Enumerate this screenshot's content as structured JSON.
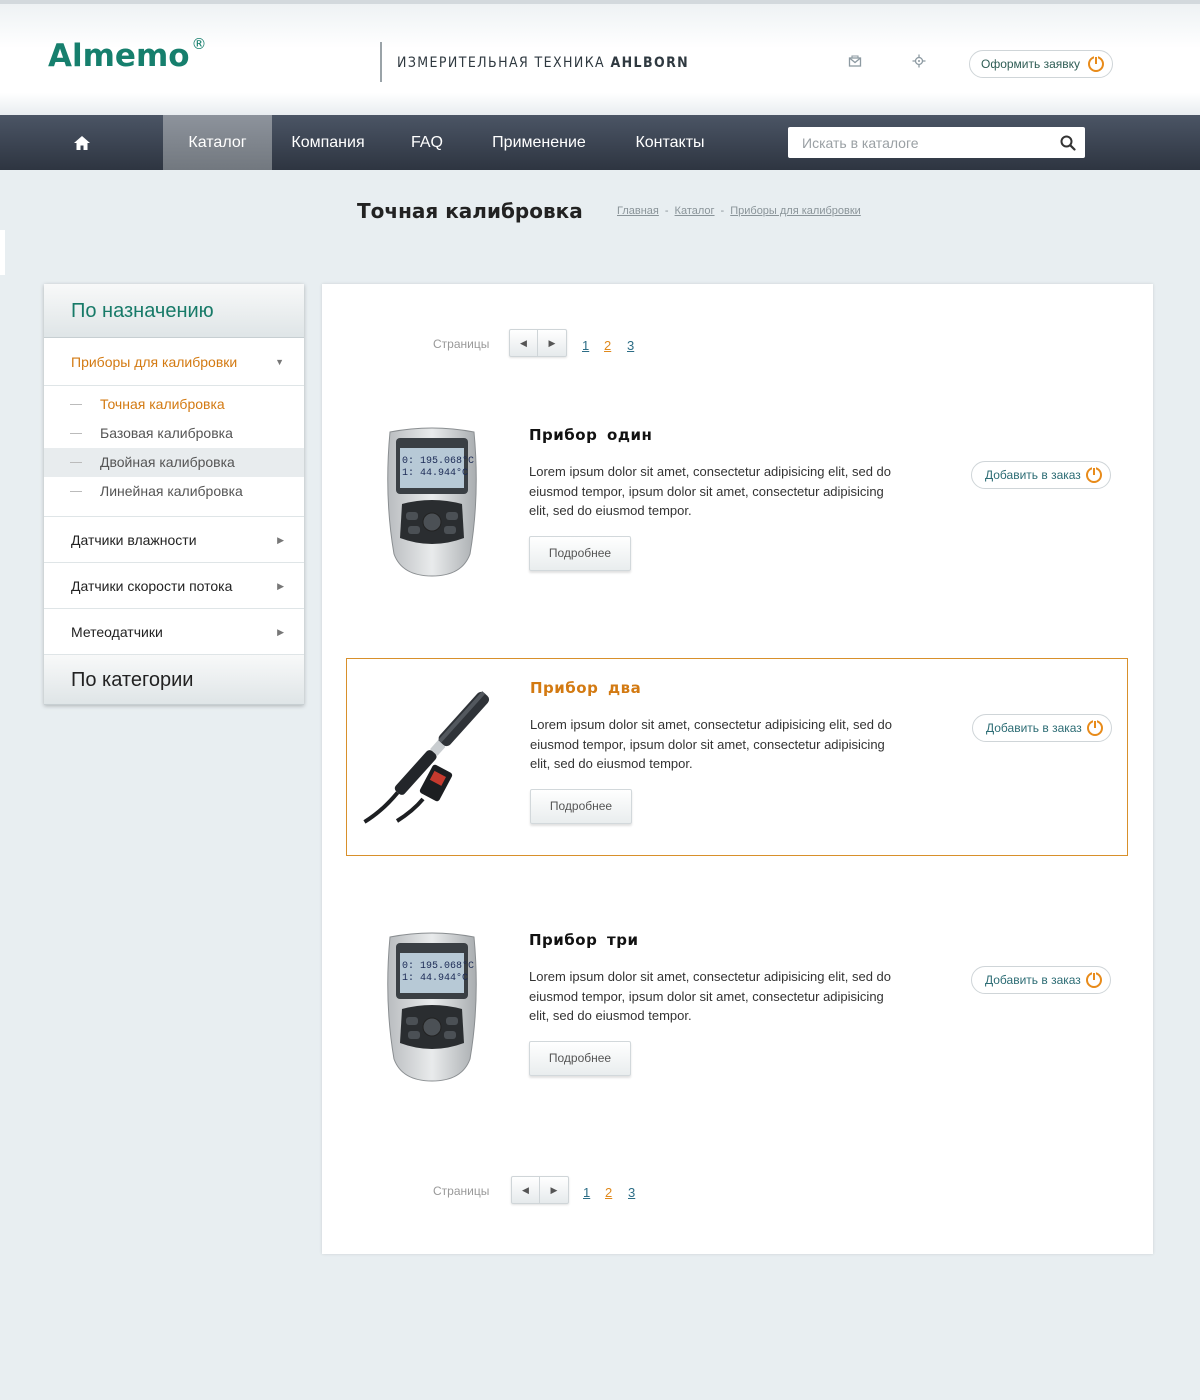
{
  "header": {
    "logo": "Almemo",
    "logo_reg": "®",
    "tagline_prefix": "ИЗМЕРИТЕЛЬНАЯ ТЕХНИКА ",
    "tagline_brand": "AHLBORN",
    "order_button": "Оформить заявку",
    "icons": [
      "mail-icon",
      "map-pin-icon",
      "power-icon"
    ]
  },
  "nav": {
    "home_icon": "home-icon",
    "items": [
      {
        "label": "Каталог",
        "active": true
      },
      {
        "label": "Компания"
      },
      {
        "label": "FAQ"
      },
      {
        "label": "Применение"
      },
      {
        "label": "Контакты"
      }
    ],
    "search_placeholder": "Искать в каталоге",
    "search_icon": "search-icon"
  },
  "page": {
    "title": "Точная калибровка",
    "breadcrumb": [
      "Главная",
      "Каталог",
      "Приборы для калибровки"
    ],
    "breadcrumb_sep": "-"
  },
  "sidebar": {
    "heading_purpose": "По назначению",
    "open_category": "Приборы для калибровки",
    "subitems": [
      {
        "label": "Точная калибровка",
        "current": true
      },
      {
        "label": "Базовая калибровка"
      },
      {
        "label": "Двойная калибровка"
      },
      {
        "label": "Линейная калибровка"
      }
    ],
    "categories": [
      "Датчики влажности",
      "Датчики скорости потока",
      "Метеодатчики"
    ],
    "heading_category": "По категории"
  },
  "pager": {
    "label": "Страницы",
    "pages": [
      "1",
      "2",
      "3"
    ],
    "current": "2"
  },
  "products": [
    {
      "name": "Прибор один",
      "description": "Lorem ipsum dolor sit amet, consectetur adipisicing elit, sed do eiusmod tempor, ipsum dolor sit amet, consectetur adipisicing elit, sed do eiusmod tempor.",
      "more": "Подробнее",
      "add": "Добавить в заказ",
      "device_readout": [
        "0: 195.068°C",
        "1: 44.944°C"
      ]
    },
    {
      "name": "Прибор два",
      "description": "Lorem ipsum dolor sit amet, consectetur adipisicing elit, sed do eiusmod tempor, ipsum dolor sit amet, consectetur adipisicing elit, sed do eiusmod tempor.",
      "more": "Подробнее",
      "add": "Добавить в заказ",
      "highlighted": true
    },
    {
      "name": "Прибор три",
      "description": "Lorem ipsum dolor sit amet, consectetur adipisicing elit, sed do eiusmod tempor, ipsum dolor sit amet, consectetur adipisicing elit, sed do eiusmod tempor.",
      "more": "Подробнее",
      "add": "Добавить в заказ",
      "device_readout": [
        "0: 195.068°C",
        "1: 44.944°C"
      ]
    }
  ],
  "colors": {
    "brand_green": "#167f6d",
    "accent_orange": "#e88b1a",
    "nav_dark": "#343b47"
  }
}
